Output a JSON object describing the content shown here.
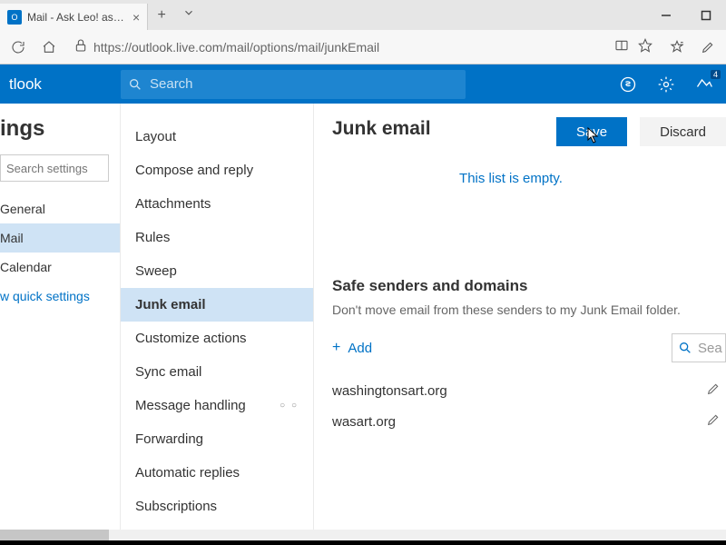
{
  "browser": {
    "tab_title": "Mail - Ask Leo! askleo.c",
    "url": "https://outlook.live.com/mail/options/mail/junkEmail"
  },
  "appbar": {
    "app_name": "tlook",
    "search_placeholder": "Search",
    "bell_count": "4"
  },
  "side1": {
    "heading": "ings",
    "search_placeholder": "Search settings",
    "items": [
      "General",
      "Mail",
      "Calendar"
    ],
    "active_index": 1,
    "quick_link": "w quick settings"
  },
  "side2": {
    "items": [
      "Layout",
      "Compose and reply",
      "Attachments",
      "Rules",
      "Sweep",
      "Junk email",
      "Customize actions",
      "Sync email",
      "Message handling",
      "Forwarding",
      "Automatic replies",
      "Subscriptions"
    ],
    "active_index": 5,
    "dots_index": 8
  },
  "main": {
    "title": "Junk email",
    "save_label": "Save",
    "discard_label": "Discard",
    "empty_message": "This list is empty.",
    "safe_heading": "Safe senders and domains",
    "safe_desc": "Don't move email from these senders to my Junk Email folder.",
    "add_label": "Add",
    "mini_search_placeholder": "Sea",
    "entries": [
      "washingtonsart.org",
      "wasart.org"
    ]
  }
}
